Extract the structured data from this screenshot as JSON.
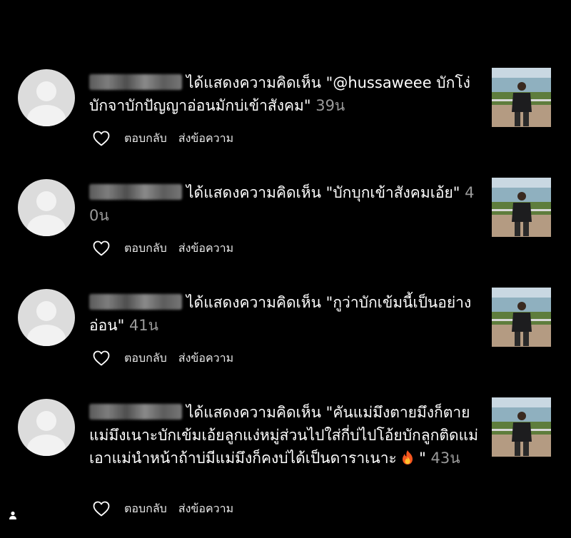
{
  "notifications": [
    {
      "author_blurred": true,
      "text": "ได้แสดงความคิดเห็น \"@hussaweee บักโง่บักจาบักปัญญาอ่อนมักบ่เข้าสังคม\"",
      "time": "39น",
      "reply_label": "ตอบกลับ",
      "message_label": "ส่งข้อความ"
    },
    {
      "author_blurred": true,
      "text": "ได้แสดงความคิดเห็น \"บักบุกเข้าสังคมเอ้ย\"",
      "time": "40น",
      "reply_label": "ตอบกลับ",
      "message_label": "ส่งข้อความ"
    },
    {
      "author_blurred": true,
      "text": "ได้แสดงความคิดเห็น \"กูว่าบักเข้มนี้เป็นอย่างอ่อน\"",
      "time": "41น",
      "reply_label": "ตอบกลับ",
      "message_label": "ส่งข้อความ"
    },
    {
      "author_blurred": true,
      "text": "ได้แสดงความคิดเห็น \"คันแม่มึงตายมึงก็ตายแม่มึงเนาะบักเข้มเอ้ยลูกแง่หมู่ส่วนไปใส่กี่บ่ไปโอ้ยบักลูกติดแม่เอาแม่นำหน้าถ้าบ่มีแม่มึงก็คงบ่ได้เป็นดาราเนาะ",
      "text_tail": "\"",
      "emoji": "fire-emoji",
      "time": "43น",
      "reply_label": "ตอบกลับ",
      "message_label": "ส่งข้อความ"
    }
  ],
  "icons": {
    "like": "heart-outline-icon",
    "avatar": "default-avatar-icon",
    "bottom_left": "person-icon"
  },
  "colors": {
    "background": "#000000",
    "text": "#ffffff",
    "timestamp": "#9a9a9a",
    "avatar": "#dcdcdc"
  }
}
